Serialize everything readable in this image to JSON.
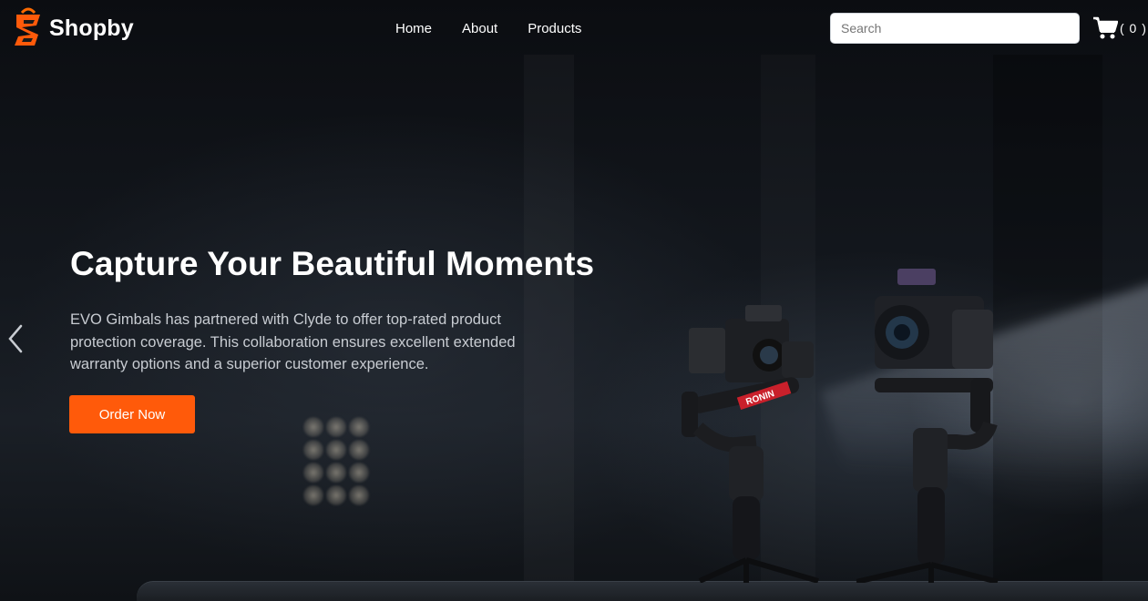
{
  "brand": {
    "name": "Shopby",
    "accent": "#ff5a0a"
  },
  "nav": {
    "links": [
      {
        "label": "Home"
      },
      {
        "label": "About"
      },
      {
        "label": "Products"
      }
    ],
    "search_placeholder": "Search",
    "search_value": "",
    "cart_count_text": "( 0 )",
    "cart_icon": "cart-icon"
  },
  "hero": {
    "title": "Capture Your Beautiful Moments",
    "description": "EVO Gimbals has partnered with Clyde to offer top-rated product protection coverage. This collaboration ensures excellent extended warranty options and a superior customer experience.",
    "cta_label": "Order Now",
    "prev_icon": "chevron-left-icon",
    "gimbal_brand_text": "RONIN"
  }
}
